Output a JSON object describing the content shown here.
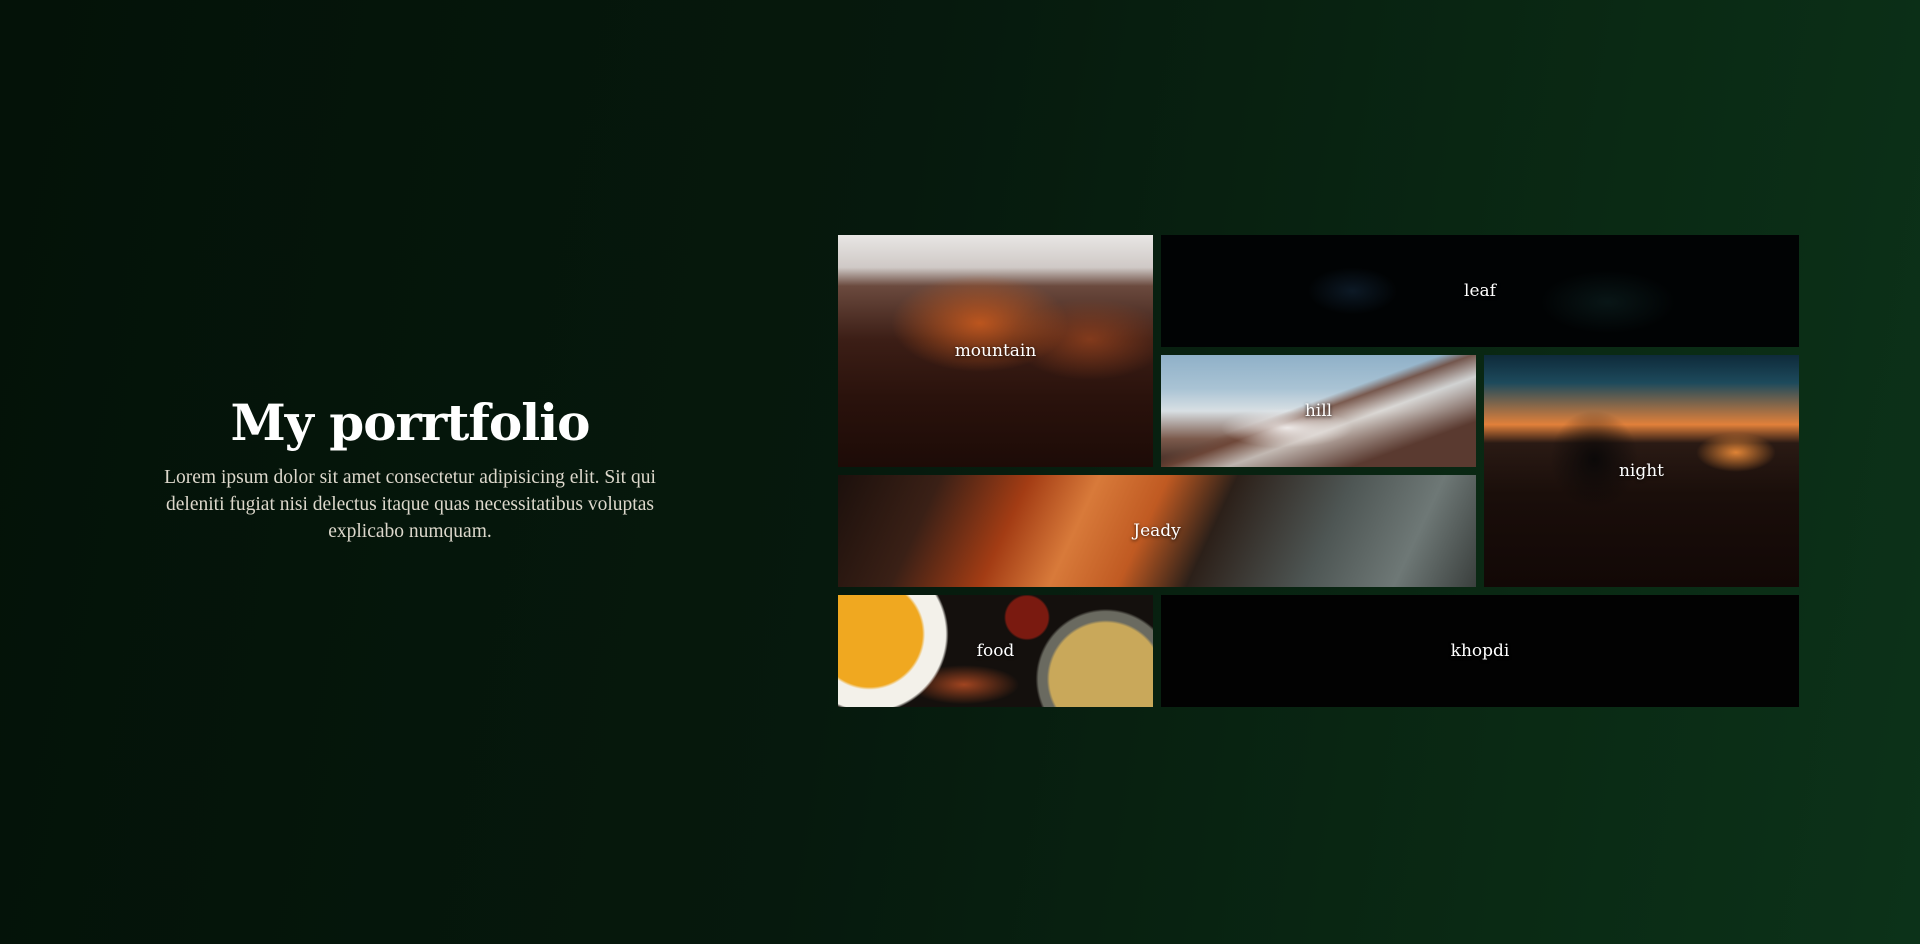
{
  "intro": {
    "title": "My porrtfolio",
    "description": "Lorem ipsum dolor sit amet consectetur adipisicing elit. Sit qui deleniti fugiat nisi delectus itaque quas necessitatibus voluptas explicabo numquam."
  },
  "gallery": {
    "tiles": [
      {
        "label": "mountain"
      },
      {
        "label": "leaf"
      },
      {
        "label": "hill"
      },
      {
        "label": "night"
      },
      {
        "label": "Jeady"
      },
      {
        "label": "food"
      },
      {
        "label": "khopdi"
      }
    ]
  }
}
